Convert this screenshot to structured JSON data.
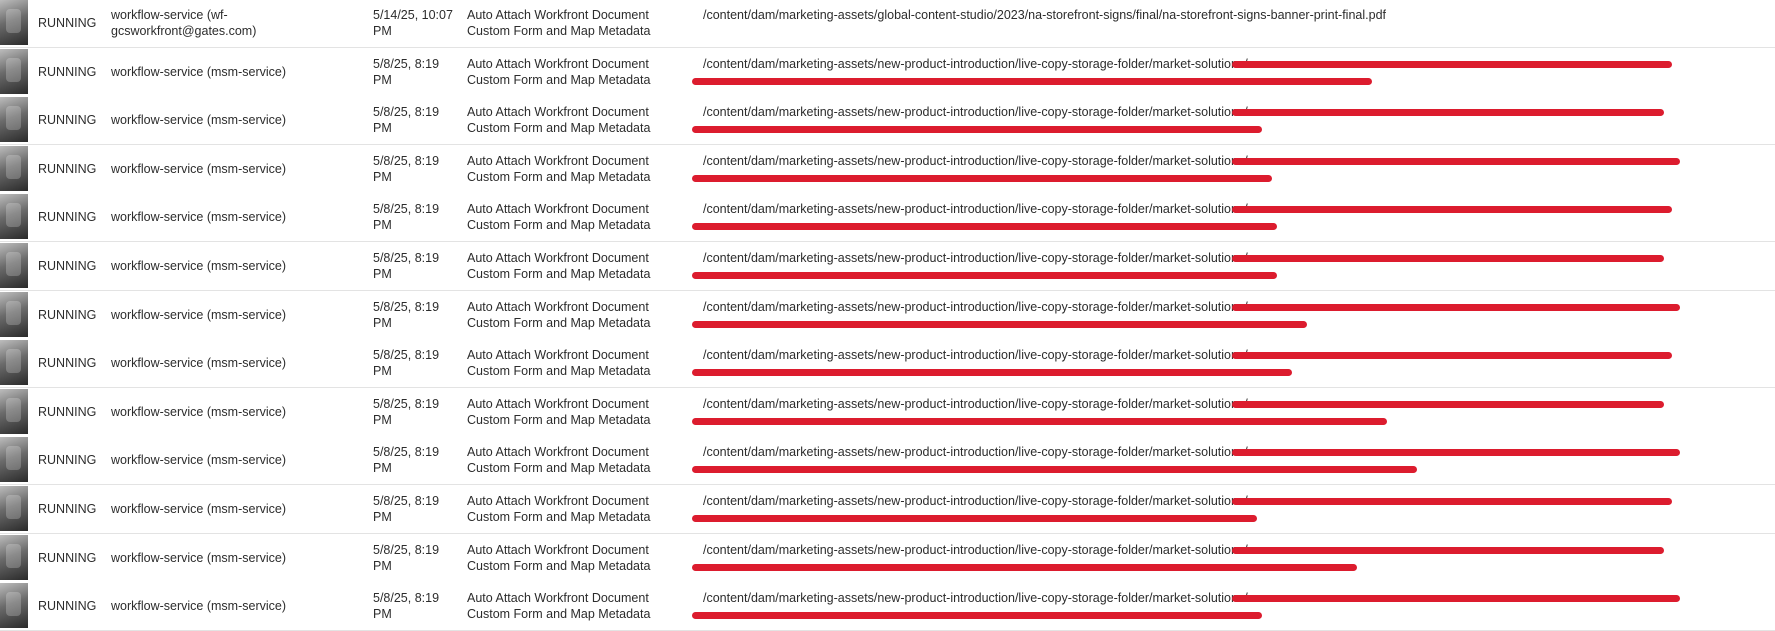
{
  "table": {
    "redaction_color": "#dc1c2e",
    "rows": [
      {
        "status": "RUNNING",
        "initiator": "workflow-service (wf-gcsworkfront@gates.com)",
        "started": "5/14/25, 10:07 PM",
        "model": "Auto Attach Workfront Document Custom Form and Map Metadata",
        "payload_path": "/content/dam/marketing-assets/global-content-studio/2023/na-storefront-signs/final/na-storefront-signs-banner-print-final.pdf"
      },
      {
        "status": "RUNNING",
        "initiator": "workflow-service (msm-service)",
        "started": "5/8/25, 8:19 PM",
        "model": "Auto Attach Workfront Document Custom Form and Map Metadata",
        "payload_path": "/content/dam/marketing-assets/new-product-introduction/live-copy-storage-folder/market-solutions/"
      },
      {
        "status": "RUNNING",
        "initiator": "workflow-service (msm-service)",
        "started": "5/8/25, 8:19 PM",
        "model": "Auto Attach Workfront Document Custom Form and Map Metadata",
        "payload_path": "/content/dam/marketing-assets/new-product-introduction/live-copy-storage-folder/market-solutions/"
      },
      {
        "status": "RUNNING",
        "initiator": "workflow-service (msm-service)",
        "started": "5/8/25, 8:19 PM",
        "model": "Auto Attach Workfront Document Custom Form and Map Metadata",
        "payload_path": "/content/dam/marketing-assets/new-product-introduction/live-copy-storage-folder/market-solutions/"
      },
      {
        "status": "RUNNING",
        "initiator": "workflow-service (msm-service)",
        "started": "5/8/25, 8:19 PM",
        "model": "Auto Attach Workfront Document Custom Form and Map Metadata",
        "payload_path": "/content/dam/marketing-assets/new-product-introduction/live-copy-storage-folder/market-solutions/"
      },
      {
        "status": "RUNNING",
        "initiator": "workflow-service (msm-service)",
        "started": "5/8/25, 8:19 PM",
        "model": "Auto Attach Workfront Document Custom Form and Map Metadata",
        "payload_path": "/content/dam/marketing-assets/new-product-introduction/live-copy-storage-folder/market-solutions/"
      },
      {
        "status": "RUNNING",
        "initiator": "workflow-service (msm-service)",
        "started": "5/8/25, 8:19 PM",
        "model": "Auto Attach Workfront Document Custom Form and Map Metadata",
        "payload_path": "/content/dam/marketing-assets/new-product-introduction/live-copy-storage-folder/market-solutions/"
      },
      {
        "status": "RUNNING",
        "initiator": "workflow-service (msm-service)",
        "started": "5/8/25, 8:19 PM",
        "model": "Auto Attach Workfront Document Custom Form and Map Metadata",
        "payload_path": "/content/dam/marketing-assets/new-product-introduction/live-copy-storage-folder/market-solutions/"
      },
      {
        "status": "RUNNING",
        "initiator": "workflow-service (msm-service)",
        "started": "5/8/25, 8:19 PM",
        "model": "Auto Attach Workfront Document Custom Form and Map Metadata",
        "payload_path": "/content/dam/marketing-assets/new-product-introduction/live-copy-storage-folder/market-solutions/"
      },
      {
        "status": "RUNNING",
        "initiator": "workflow-service (msm-service)",
        "started": "5/8/25, 8:19 PM",
        "model": "Auto Attach Workfront Document Custom Form and Map Metadata",
        "payload_path": "/content/dam/marketing-assets/new-product-introduction/live-copy-storage-folder/market-solutions/"
      },
      {
        "status": "RUNNING",
        "initiator": "workflow-service (msm-service)",
        "started": "5/8/25, 8:19 PM",
        "model": "Auto Attach Workfront Document Custom Form and Map Metadata",
        "payload_path": "/content/dam/marketing-assets/new-product-introduction/live-copy-storage-folder/market-solutions/"
      },
      {
        "status": "RUNNING",
        "initiator": "workflow-service (msm-service)",
        "started": "5/8/25, 8:19 PM",
        "model": "Auto Attach Workfront Document Custom Form and Map Metadata",
        "payload_path": "/content/dam/marketing-assets/new-product-introduction/live-copy-storage-folder/market-solutions/"
      },
      {
        "status": "RUNNING",
        "initiator": "workflow-service (msm-service)",
        "started": "5/8/25, 8:19 PM",
        "model": "Auto Attach Workfront Document Custom Form and Map Metadata",
        "payload_path": "/content/dam/marketing-assets/new-product-introduction/live-copy-storage-folder/market-solutions/"
      }
    ]
  }
}
